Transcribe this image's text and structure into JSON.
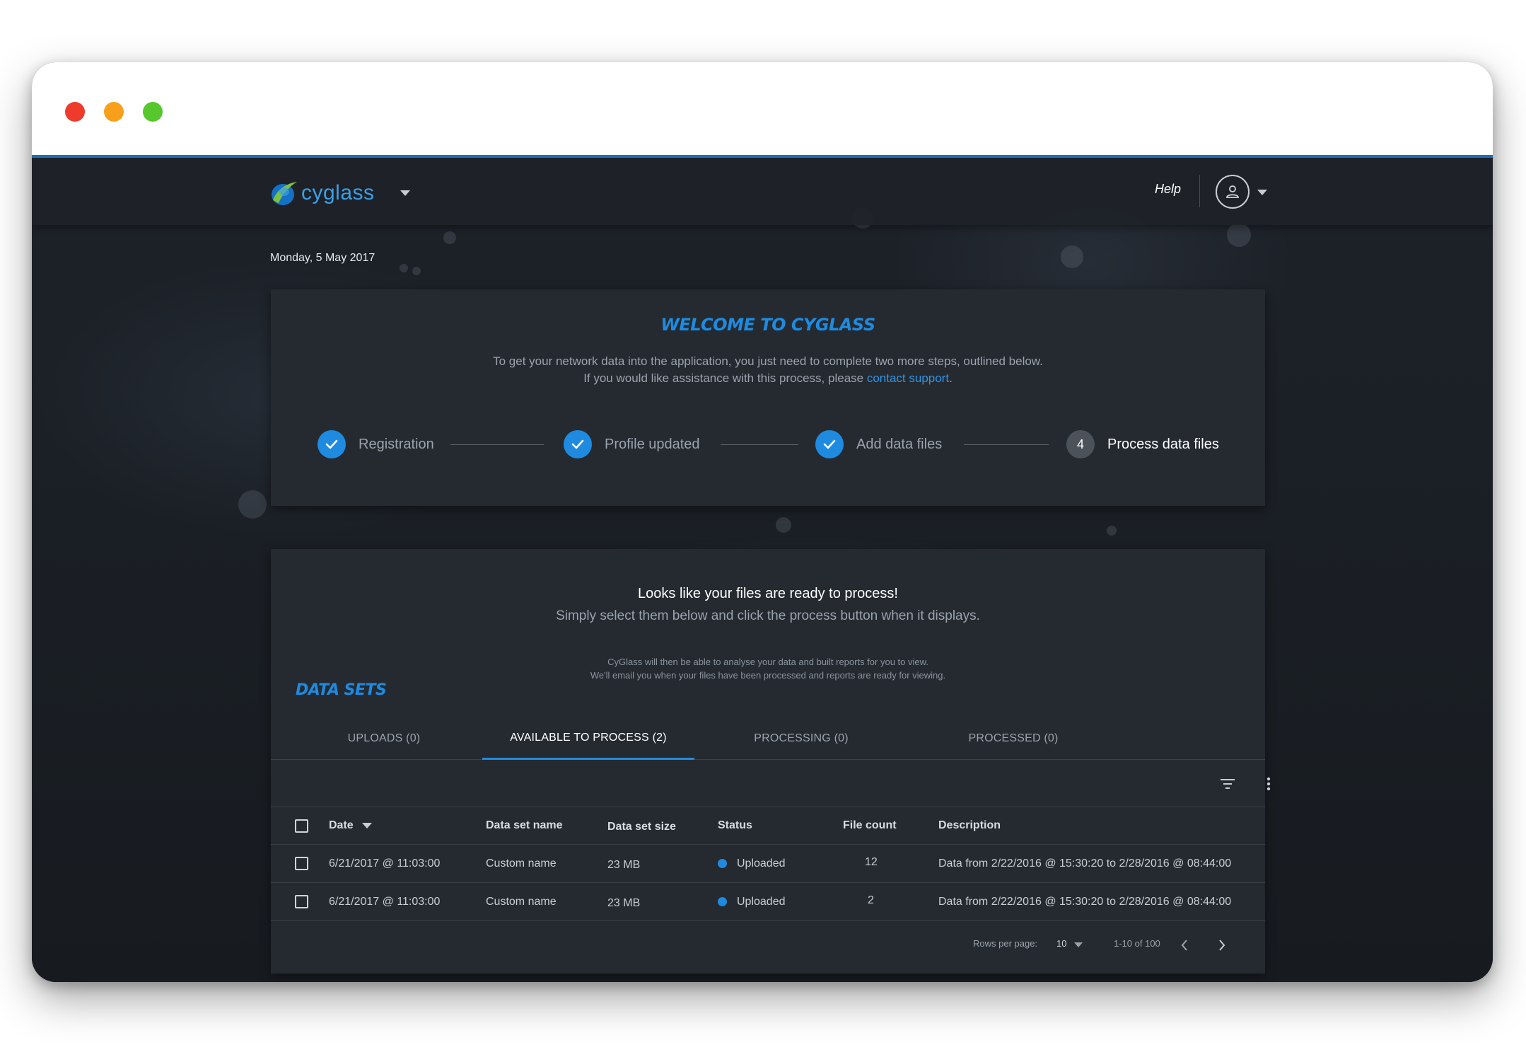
{
  "window": {
    "controls": [
      "close",
      "minimize",
      "maximize"
    ]
  },
  "navbar": {
    "logo_text": "cyglass",
    "help_label": "Help",
    "user_icon": "user-icon"
  },
  "date_label": "Monday, 5 May 2017",
  "welcome": {
    "title": "WELCOME TO CYGLASS",
    "text_line1": "To get your network data into the application, you just need to complete two more steps, outlined below.",
    "text_line2_prefix": "If you would like assistance with this process, please ",
    "contact_link": "contact support",
    "text_line2_suffix": ".",
    "steps": [
      {
        "label": "Registration",
        "state": "done"
      },
      {
        "label": "Profile updated",
        "state": "done"
      },
      {
        "label": "Add data files",
        "state": "done"
      },
      {
        "label": "Process data files",
        "state": "current",
        "number": "4"
      }
    ]
  },
  "datasets": {
    "ready_title": "Looks like your files are ready to process!",
    "ready_sub": "Simply select them below and click the process button when it displays.",
    "note_line1": "CyGlass will then be able to analyse your data and built reports for you to view.",
    "note_line2": "We'll email you when your files have been processed and reports are ready for viewing.",
    "section_title": "DATA SETS",
    "tabs": [
      {
        "label": "UPLOADS (0)",
        "active": false
      },
      {
        "label": "AVAILABLE TO PROCESS (2)",
        "active": true
      },
      {
        "label": "PROCESSING (0)",
        "active": false
      },
      {
        "label": "PROCESSED (0)",
        "active": false
      }
    ],
    "columns": {
      "date": "Date",
      "name": "Data set name",
      "size": "Data set size",
      "status": "Status",
      "count": "File count",
      "description": "Description"
    },
    "rows": [
      {
        "date": "6/21/2017 @ 11:03:00",
        "name": "Custom name",
        "size": "23 MB",
        "status": "Uploaded",
        "count": "12",
        "description": "Data from 2/22/2016 @ 15:30:20 to 2/28/2016 @ 08:44:00"
      },
      {
        "date": "6/21/2017 @ 11:03:00",
        "name": "Custom name",
        "size": "23 MB",
        "status": "Uploaded",
        "count": "2",
        "description": "Data from 2/22/2016 @ 15:30:20 to 2/28/2016 @ 08:44:00"
      }
    ],
    "pagination": {
      "rows_per_page_label": "Rows per page:",
      "rows_per_page_value": "10",
      "range": "1-10 of 100"
    }
  },
  "colors": {
    "accent": "#1e8be0",
    "card_bg": "#252a31",
    "app_bg": "#1a1e24",
    "close": "#ee3b2c",
    "minimize": "#f8a01c",
    "maximize": "#56c72c"
  }
}
